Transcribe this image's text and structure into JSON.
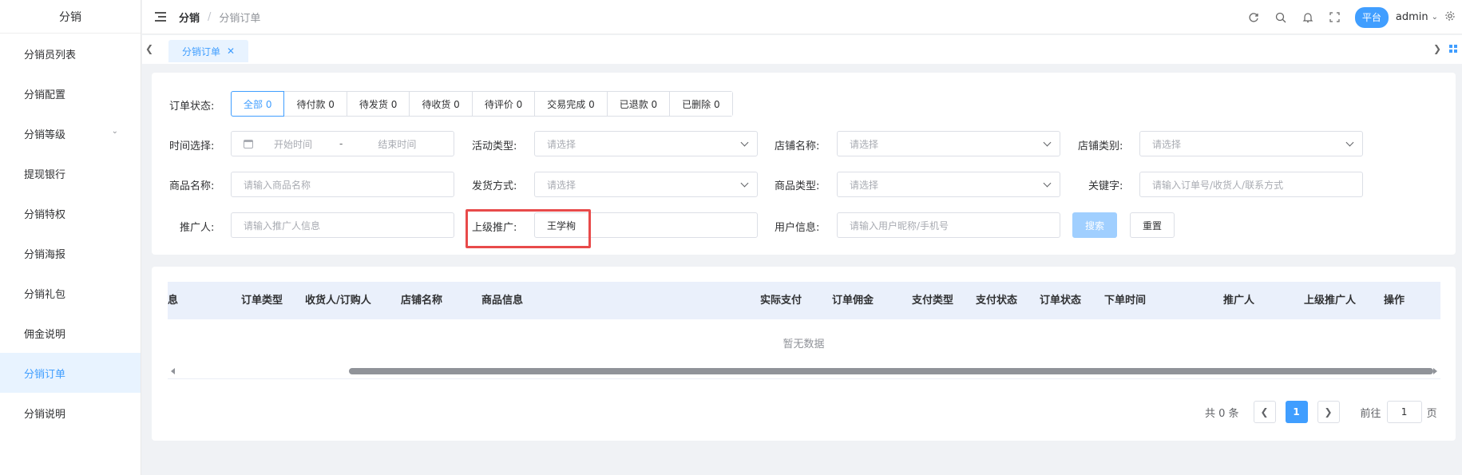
{
  "sidebar": {
    "title": "分销",
    "items": [
      {
        "label": "分销员列表"
      },
      {
        "label": "分销配置"
      },
      {
        "label": "分销等级"
      },
      {
        "label": "提现银行"
      },
      {
        "label": "分销特权"
      },
      {
        "label": "分销海报"
      },
      {
        "label": "分销礼包"
      },
      {
        "label": "佣金说明"
      },
      {
        "label": "分销订单"
      },
      {
        "label": "分销说明"
      }
    ]
  },
  "header": {
    "breadcrumb": [
      "分销",
      "分销订单"
    ],
    "platform_label": "平台",
    "user": "admin"
  },
  "tags": {
    "active": "分销订单"
  },
  "filters": {
    "order_status_label": "订单状态:",
    "status_tabs": [
      "全部 0",
      "待付款 0",
      "待发货 0",
      "待收货 0",
      "待评价 0",
      "交易完成 0",
      "已退款 0",
      "已删除 0"
    ],
    "time_label": "时间选择:",
    "start_placeholder": "开始时间",
    "date_sep": "-",
    "end_placeholder": "结束时间",
    "activity_label": "活动类型:",
    "activity_placeholder": "请选择",
    "shop_name_label": "店铺名称:",
    "shop_name_placeholder": "请选择",
    "shop_type_label": "店铺类别:",
    "shop_type_placeholder": "请选择",
    "goods_name_label": "商品名称:",
    "goods_name_placeholder": "请输入商品名称",
    "delivery_label": "发货方式:",
    "delivery_placeholder": "请选择",
    "goods_type_label": "商品类型:",
    "goods_type_placeholder": "请选择",
    "keyword_label": "关键字:",
    "keyword_placeholder": "请输入订单号/收货人/联系方式",
    "promoter_label": "推广人:",
    "promoter_placeholder": "请输入推广人信息",
    "upper_promoter_label": "上级推广:",
    "upper_promoter_value": "王学栒",
    "user_info_label": "用户信息:",
    "user_info_placeholder": "请输入用户昵称/手机号",
    "search_label": "搜索",
    "reset_label": "重置"
  },
  "table": {
    "columns": [
      "息",
      "订单类型",
      "收货人/订购人",
      "店铺名称",
      "商品信息",
      "实际支付",
      "订单佣金",
      "支付类型",
      "支付状态",
      "订单状态",
      "下单时间",
      "推广人",
      "上级推广人",
      "操作"
    ],
    "empty_text": "暂无数据"
  },
  "pagination": {
    "total_text": "共 0 条",
    "current_page": "1",
    "goto_label": "前往",
    "goto_value": "1",
    "page_suffix": "页"
  },
  "colors": {
    "accent": "#409eff",
    "highlight": "#e84a4a"
  }
}
